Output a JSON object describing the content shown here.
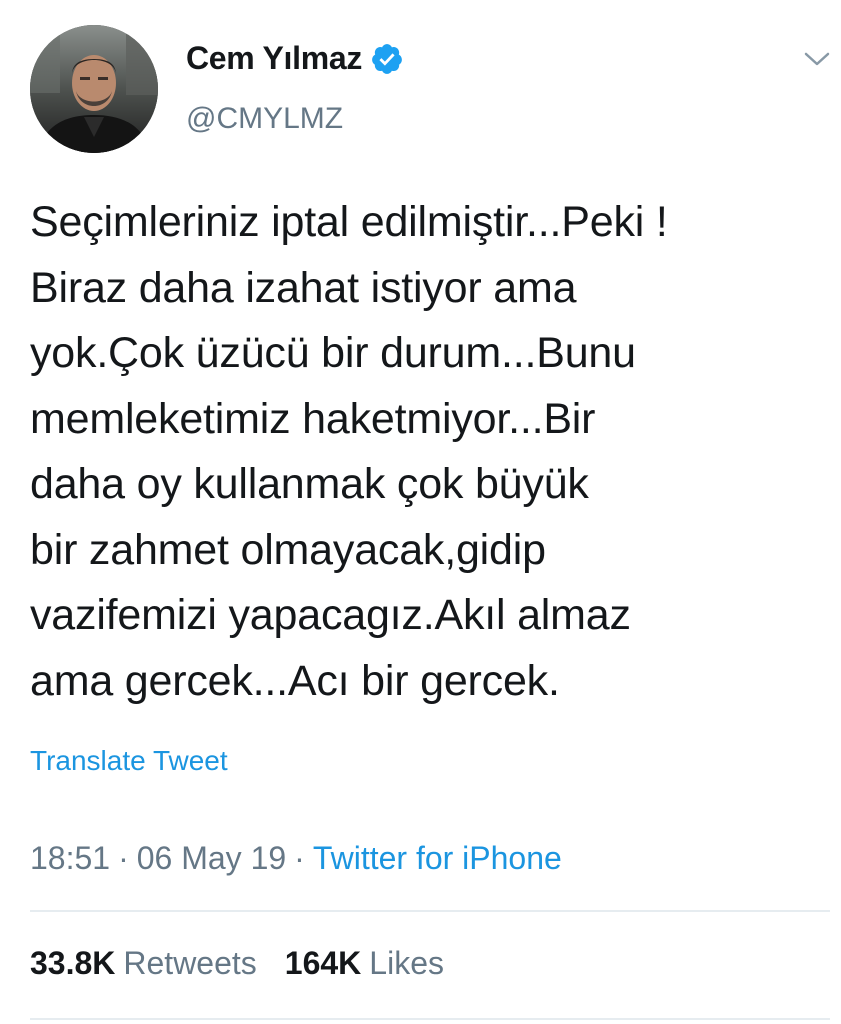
{
  "author": {
    "name": "Cem Yılmaz",
    "handle": "@CMYLMZ",
    "verified": true
  },
  "tweet": {
    "text": "Seçimleriniz iptal edilmiştir...Peki !\nBiraz daha izahat istiyor ama\nyok.Çok üzücü bir durum...Bunu\nmemleketimiz haketmiyor...Bir\ndaha oy kullanmak çok büyük\nbir zahmet olmayacak,gidip\nvazifemizi yapacagız.Akıl almaz\nama gercek...Acı bir gercek.",
    "translate_label": "Translate Tweet",
    "time": "18:51",
    "date": "06 May 19",
    "separator": "·",
    "source": "Twitter for iPhone"
  },
  "stats": {
    "retweets_count": "33.8K",
    "retweets_label": "Retweets",
    "likes_count": "164K",
    "likes_label": "Likes"
  },
  "icons": {
    "verified": "verified-badge-icon",
    "menu": "chevron-down-icon"
  },
  "colors": {
    "link": "#1b95e0",
    "secondary_text": "#657786",
    "primary_text": "#14171a",
    "divider": "#e6ecf0"
  }
}
